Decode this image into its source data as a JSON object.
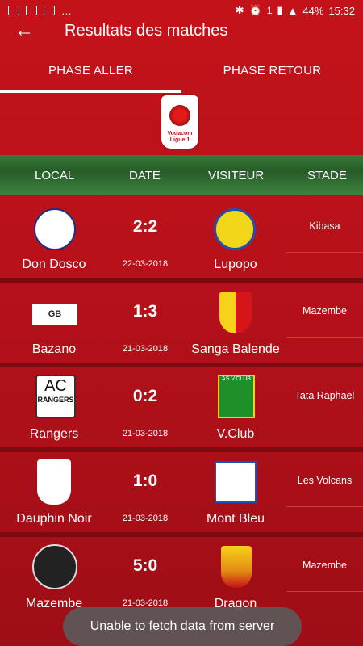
{
  "status_bar": {
    "battery": "44%",
    "time": "15:32",
    "network": "1"
  },
  "header": {
    "title": "Resultats des matches"
  },
  "tabs": [
    {
      "label": "PHASE ALLER",
      "active": true
    },
    {
      "label": "PHASE RETOUR",
      "active": false
    }
  ],
  "logo_text": "Vodacom Ligue 1",
  "columns": {
    "local": "LOCAL",
    "date": "DATE",
    "visiteur": "VISITEUR",
    "stade": "STADE"
  },
  "matches": [
    {
      "home": "Don Dosco",
      "score": "2:2",
      "date": "22-03-2018",
      "away": "Lupopo",
      "stadium": "Kibasa"
    },
    {
      "home": "Bazano",
      "score": "1:3",
      "date": "21-03-2018",
      "away": "Sanga Balende",
      "stadium": "Mazembe"
    },
    {
      "home": "Rangers",
      "score": "0:2",
      "date": "21-03-2018",
      "away": "V.Club",
      "stadium": "Tata Raphael"
    },
    {
      "home": "Dauphin Noir",
      "score": "1:0",
      "date": "21-03-2018",
      "away": "Mont Bleu",
      "stadium": "Les Volcans"
    },
    {
      "home": "Mazembe",
      "score": "5:0",
      "date": "21-03-2018",
      "away": "Dragon",
      "stadium": "Mazembe"
    }
  ],
  "crest_text": {
    "rangers_top": "AC",
    "rangers_bottom": "RANGERS",
    "vclub": "AS V.CLUB",
    "bazano": "GB"
  },
  "toast": "Unable to fetch data from server",
  "colors": {
    "primary": "#c4121a",
    "dark": "#7c0a0f",
    "green_header": "#2f6b30"
  }
}
